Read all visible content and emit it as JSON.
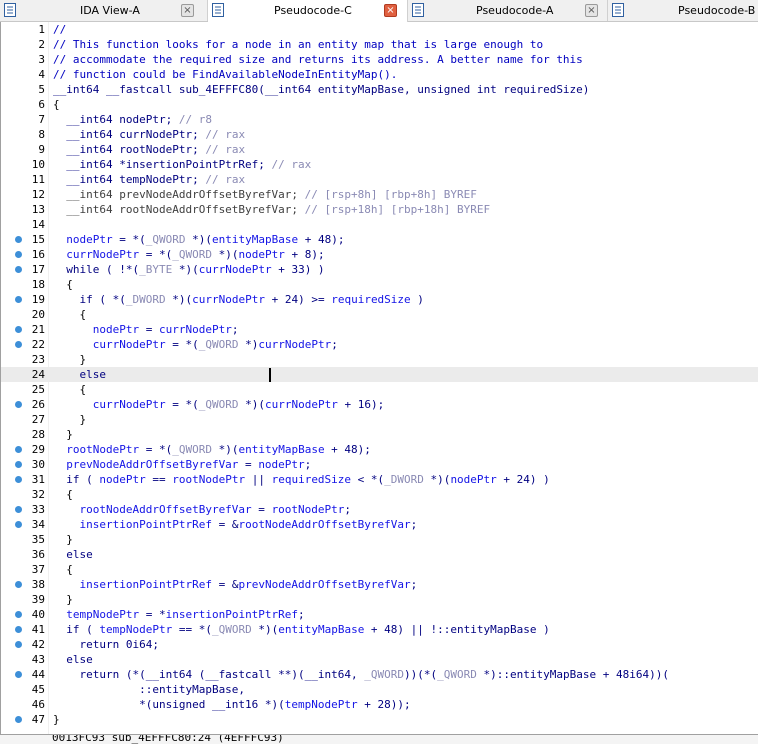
{
  "tabs": [
    {
      "label": "IDA View-A",
      "icon": "ida-view-icon",
      "active": false
    },
    {
      "label": "Pseudocode-C",
      "icon": "pseudocode-icon",
      "active": true
    },
    {
      "label": "Pseudocode-A",
      "icon": "pseudocode-icon",
      "active": false
    },
    {
      "label": "Pseudocode-B",
      "icon": "pseudocode-icon",
      "active": false
    }
  ],
  "close_glyph": "×",
  "highlighted_line": 24,
  "lines": [
    {
      "n": "1",
      "bp": false,
      "segs": [
        [
          "cmt",
          "//"
        ]
      ]
    },
    {
      "n": "2",
      "bp": false,
      "segs": [
        [
          "cmt",
          "// This function looks for a node in an entity map that is large enough to"
        ]
      ]
    },
    {
      "n": "3",
      "bp": false,
      "segs": [
        [
          "cmt",
          "// accommodate the required size and returns its address. A better name for this"
        ]
      ]
    },
    {
      "n": "4",
      "bp": false,
      "segs": [
        [
          "cmt",
          "// function could be FindAvailableNodeInEntityMap()."
        ]
      ]
    },
    {
      "n": "5",
      "bp": false,
      "segs": [
        [
          "syn",
          "__int64 __fastcall sub_4EFFFC80(__int64 entityMapBase, unsigned int requiredSize)"
        ]
      ]
    },
    {
      "n": "6",
      "bp": false,
      "segs": [
        [
          "kw",
          "{"
        ]
      ]
    },
    {
      "n": "7",
      "bp": false,
      "segs": [
        [
          "syn",
          "  __int64 nodePtr; "
        ],
        [
          "dim",
          "// r8"
        ]
      ]
    },
    {
      "n": "8",
      "bp": false,
      "segs": [
        [
          "syn",
          "  __int64 currNodePtr; "
        ],
        [
          "dim",
          "// rax"
        ]
      ]
    },
    {
      "n": "9",
      "bp": false,
      "segs": [
        [
          "syn",
          "  __int64 rootNodePtr; "
        ],
        [
          "dim",
          "// rax"
        ]
      ]
    },
    {
      "n": "10",
      "bp": false,
      "segs": [
        [
          "syn",
          "  __int64 *insertionPointPtrRef; "
        ],
        [
          "dim",
          "// rax"
        ]
      ]
    },
    {
      "n": "11",
      "bp": false,
      "segs": [
        [
          "syn",
          "  __int64 tempNodePtr; "
        ],
        [
          "dim",
          "// rax"
        ]
      ]
    },
    {
      "n": "12",
      "bp": false,
      "segs": [
        [
          "gvar",
          "  __int64 prevNodeAddrOffsetByrefVar; "
        ],
        [
          "dim",
          "// [rsp+8h] [rbp+8h] BYREF"
        ]
      ]
    },
    {
      "n": "13",
      "bp": false,
      "segs": [
        [
          "gvar",
          "  __int64 rootNodeAddrOffsetByrefVar; "
        ],
        [
          "dim",
          "// [rsp+18h] [rbp+18h] BYREF"
        ]
      ]
    },
    {
      "n": "14",
      "bp": false,
      "segs": [
        [
          "kw",
          ""
        ]
      ]
    },
    {
      "n": "15",
      "bp": true,
      "segs": [
        [
          "var",
          "  nodePtr"
        ],
        [
          "syn",
          " = *("
        ],
        [
          "dim",
          "_QWORD"
        ],
        [
          "syn",
          " *)("
        ],
        [
          "var",
          "entityMapBase"
        ],
        [
          "syn",
          " + 48);"
        ]
      ]
    },
    {
      "n": "16",
      "bp": true,
      "segs": [
        [
          "var",
          "  currNodePtr"
        ],
        [
          "syn",
          " = *("
        ],
        [
          "dim",
          "_QWORD"
        ],
        [
          "syn",
          " *)("
        ],
        [
          "var",
          "nodePtr"
        ],
        [
          "syn",
          " + 8);"
        ]
      ]
    },
    {
      "n": "17",
      "bp": true,
      "segs": [
        [
          "syn",
          "  while ( !*("
        ],
        [
          "dim",
          "_BYTE"
        ],
        [
          "syn",
          " *)("
        ],
        [
          "var",
          "currNodePtr"
        ],
        [
          "syn",
          " + 33) )"
        ]
      ]
    },
    {
      "n": "18",
      "bp": false,
      "segs": [
        [
          "kw",
          "  {"
        ]
      ]
    },
    {
      "n": "19",
      "bp": true,
      "segs": [
        [
          "syn",
          "    if ( *("
        ],
        [
          "dim",
          "_DWORD"
        ],
        [
          "syn",
          " *)("
        ],
        [
          "var",
          "currNodePtr"
        ],
        [
          "syn",
          " + 24) >= "
        ],
        [
          "var",
          "requiredSize"
        ],
        [
          "syn",
          " )"
        ]
      ]
    },
    {
      "n": "20",
      "bp": false,
      "segs": [
        [
          "kw",
          "    {"
        ]
      ]
    },
    {
      "n": "21",
      "bp": true,
      "segs": [
        [
          "var",
          "      nodePtr"
        ],
        [
          "syn",
          " = "
        ],
        [
          "var",
          "currNodePtr"
        ],
        [
          "syn",
          ";"
        ]
      ]
    },
    {
      "n": "22",
      "bp": true,
      "segs": [
        [
          "var",
          "      currNodePtr"
        ],
        [
          "syn",
          " = *("
        ],
        [
          "dim",
          "_QWORD"
        ],
        [
          "syn",
          " *)"
        ],
        [
          "var",
          "currNodePtr"
        ],
        [
          "syn",
          ";"
        ]
      ]
    },
    {
      "n": "23",
      "bp": false,
      "segs": [
        [
          "kw",
          "    }"
        ]
      ]
    },
    {
      "n": "24",
      "bp": false,
      "segs": [
        [
          "syn",
          "    else"
        ]
      ]
    },
    {
      "n": "25",
      "bp": false,
      "segs": [
        [
          "kw",
          "    {"
        ]
      ]
    },
    {
      "n": "26",
      "bp": true,
      "segs": [
        [
          "var",
          "      currNodePtr"
        ],
        [
          "syn",
          " = *("
        ],
        [
          "dim",
          "_QWORD"
        ],
        [
          "syn",
          " *)("
        ],
        [
          "var",
          "currNodePtr"
        ],
        [
          "syn",
          " + 16);"
        ]
      ]
    },
    {
      "n": "27",
      "bp": false,
      "segs": [
        [
          "kw",
          "    }"
        ]
      ]
    },
    {
      "n": "28",
      "bp": false,
      "segs": [
        [
          "kw",
          "  }"
        ]
      ]
    },
    {
      "n": "29",
      "bp": true,
      "segs": [
        [
          "var",
          "  rootNodePtr"
        ],
        [
          "syn",
          " = *("
        ],
        [
          "dim",
          "_QWORD"
        ],
        [
          "syn",
          " *)("
        ],
        [
          "var",
          "entityMapBase"
        ],
        [
          "syn",
          " + 48);"
        ]
      ]
    },
    {
      "n": "30",
      "bp": true,
      "segs": [
        [
          "var",
          "  prevNodeAddrOffsetByrefVar"
        ],
        [
          "syn",
          " = "
        ],
        [
          "var",
          "nodePtr"
        ],
        [
          "syn",
          ";"
        ]
      ]
    },
    {
      "n": "31",
      "bp": true,
      "segs": [
        [
          "syn",
          "  if ( "
        ],
        [
          "var",
          "nodePtr"
        ],
        [
          "syn",
          " == "
        ],
        [
          "var",
          "rootNodePtr"
        ],
        [
          "syn",
          " || "
        ],
        [
          "var",
          "requiredSize"
        ],
        [
          "syn",
          " < *("
        ],
        [
          "dim",
          "_DWORD"
        ],
        [
          "syn",
          " *)("
        ],
        [
          "var",
          "nodePtr"
        ],
        [
          "syn",
          " + 24) )"
        ]
      ]
    },
    {
      "n": "32",
      "bp": false,
      "segs": [
        [
          "kw",
          "  {"
        ]
      ]
    },
    {
      "n": "33",
      "bp": true,
      "segs": [
        [
          "var",
          "    rootNodeAddrOffsetByrefVar"
        ],
        [
          "syn",
          " = "
        ],
        [
          "var",
          "rootNodePtr"
        ],
        [
          "syn",
          ";"
        ]
      ]
    },
    {
      "n": "34",
      "bp": true,
      "segs": [
        [
          "var",
          "    insertionPointPtrRef"
        ],
        [
          "syn",
          " = &"
        ],
        [
          "var",
          "rootNodeAddrOffsetByrefVar"
        ],
        [
          "syn",
          ";"
        ]
      ]
    },
    {
      "n": "35",
      "bp": false,
      "segs": [
        [
          "kw",
          "  }"
        ]
      ]
    },
    {
      "n": "36",
      "bp": false,
      "segs": [
        [
          "syn",
          "  else"
        ]
      ]
    },
    {
      "n": "37",
      "bp": false,
      "segs": [
        [
          "kw",
          "  {"
        ]
      ]
    },
    {
      "n": "38",
      "bp": true,
      "segs": [
        [
          "var",
          "    insertionPointPtrRef"
        ],
        [
          "syn",
          " = &"
        ],
        [
          "var",
          "prevNodeAddrOffsetByrefVar"
        ],
        [
          "syn",
          ";"
        ]
      ]
    },
    {
      "n": "39",
      "bp": false,
      "segs": [
        [
          "kw",
          "  }"
        ]
      ]
    },
    {
      "n": "40",
      "bp": true,
      "segs": [
        [
          "var",
          "  tempNodePtr"
        ],
        [
          "syn",
          " = *"
        ],
        [
          "var",
          "insertionPointPtrRef"
        ],
        [
          "syn",
          ";"
        ]
      ]
    },
    {
      "n": "41",
      "bp": true,
      "segs": [
        [
          "syn",
          "  if ( "
        ],
        [
          "var",
          "tempNodePtr"
        ],
        [
          "syn",
          " == *("
        ],
        [
          "dim",
          "_QWORD"
        ],
        [
          "syn",
          " *)("
        ],
        [
          "var",
          "entityMapBase"
        ],
        [
          "syn",
          " + 48) || !::entityMapBase )"
        ]
      ]
    },
    {
      "n": "42",
      "bp": true,
      "segs": [
        [
          "syn",
          "    return 0i64;"
        ]
      ]
    },
    {
      "n": "43",
      "bp": false,
      "segs": [
        [
          "syn",
          "  else"
        ]
      ]
    },
    {
      "n": "44",
      "bp": true,
      "segs": [
        [
          "syn",
          "    return (*(__int64 (__fastcall **)(__int64, "
        ],
        [
          "dim",
          "_QWORD"
        ],
        [
          "syn",
          "))(*("
        ],
        [
          "dim",
          "_QWORD"
        ],
        [
          "syn",
          " *)::entityMapBase + 48i64))("
        ]
      ]
    },
    {
      "n": "45",
      "bp": false,
      "segs": [
        [
          "syn",
          "             ::entityMapBase,"
        ]
      ]
    },
    {
      "n": "46",
      "bp": false,
      "segs": [
        [
          "syn",
          "             *(unsigned __int16 *)("
        ],
        [
          "var",
          "tempNodePtr"
        ],
        [
          "syn",
          " + 28));"
        ]
      ]
    },
    {
      "n": "47",
      "bp": true,
      "segs": [
        [
          "kw",
          "}"
        ]
      ]
    }
  ],
  "status_text": "0013FC93 sub_4EFFFC80:24 (4EFFFC93)"
}
